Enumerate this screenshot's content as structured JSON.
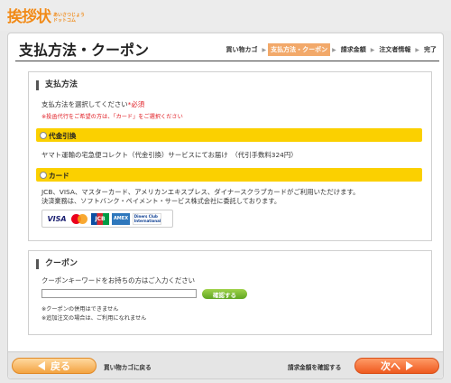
{
  "logo": {
    "main": "挨拶状",
    "sub_top": "あいさつじょう",
    "sub_bottom": "ドットコム"
  },
  "header": {
    "title": "支払方法・クーポン",
    "steps": [
      "買い物カゴ",
      "支払方法・クーポン",
      "請求金額",
      "注文者情報",
      "完了"
    ]
  },
  "payment": {
    "heading": "支払方法",
    "instruction": "支払方法を選択してください",
    "required": "*必須",
    "note": "※投函代行をご希望の方は、「カード」をご選択ください",
    "options": [
      {
        "label": "代金引換",
        "description": "ヤマト運輸の宅急便コレクト（代金引換）サービスにてお届け　（代引手数料324円）"
      },
      {
        "label": "カード",
        "description": "JCB、VISA、マスターカード、アメリカンエキスプレス、ダイナースクラブカードがご利用いただけます。",
        "description2": "決済業務は、ソフトバンク・ペイメント・サービス株式会社に委託しております。"
      }
    ],
    "card_logos": {
      "visa": "VISA",
      "jcb": "JCB",
      "amex": "AMEX",
      "diners": "Diners Club International"
    }
  },
  "coupon": {
    "heading": "クーポン",
    "instruction": "クーポンキーワードをお持ちの方はご入力ください",
    "input_value": "",
    "confirm_label": "確認する",
    "note1": "※クーポンの併用はできません",
    "note2": "※追加注文の場合は、ご利用になれません"
  },
  "footer": {
    "back_label": "戻る",
    "back_text": "買い物カゴに戻る",
    "next_text": "請求金額を確認する",
    "next_label": "次へ"
  }
}
